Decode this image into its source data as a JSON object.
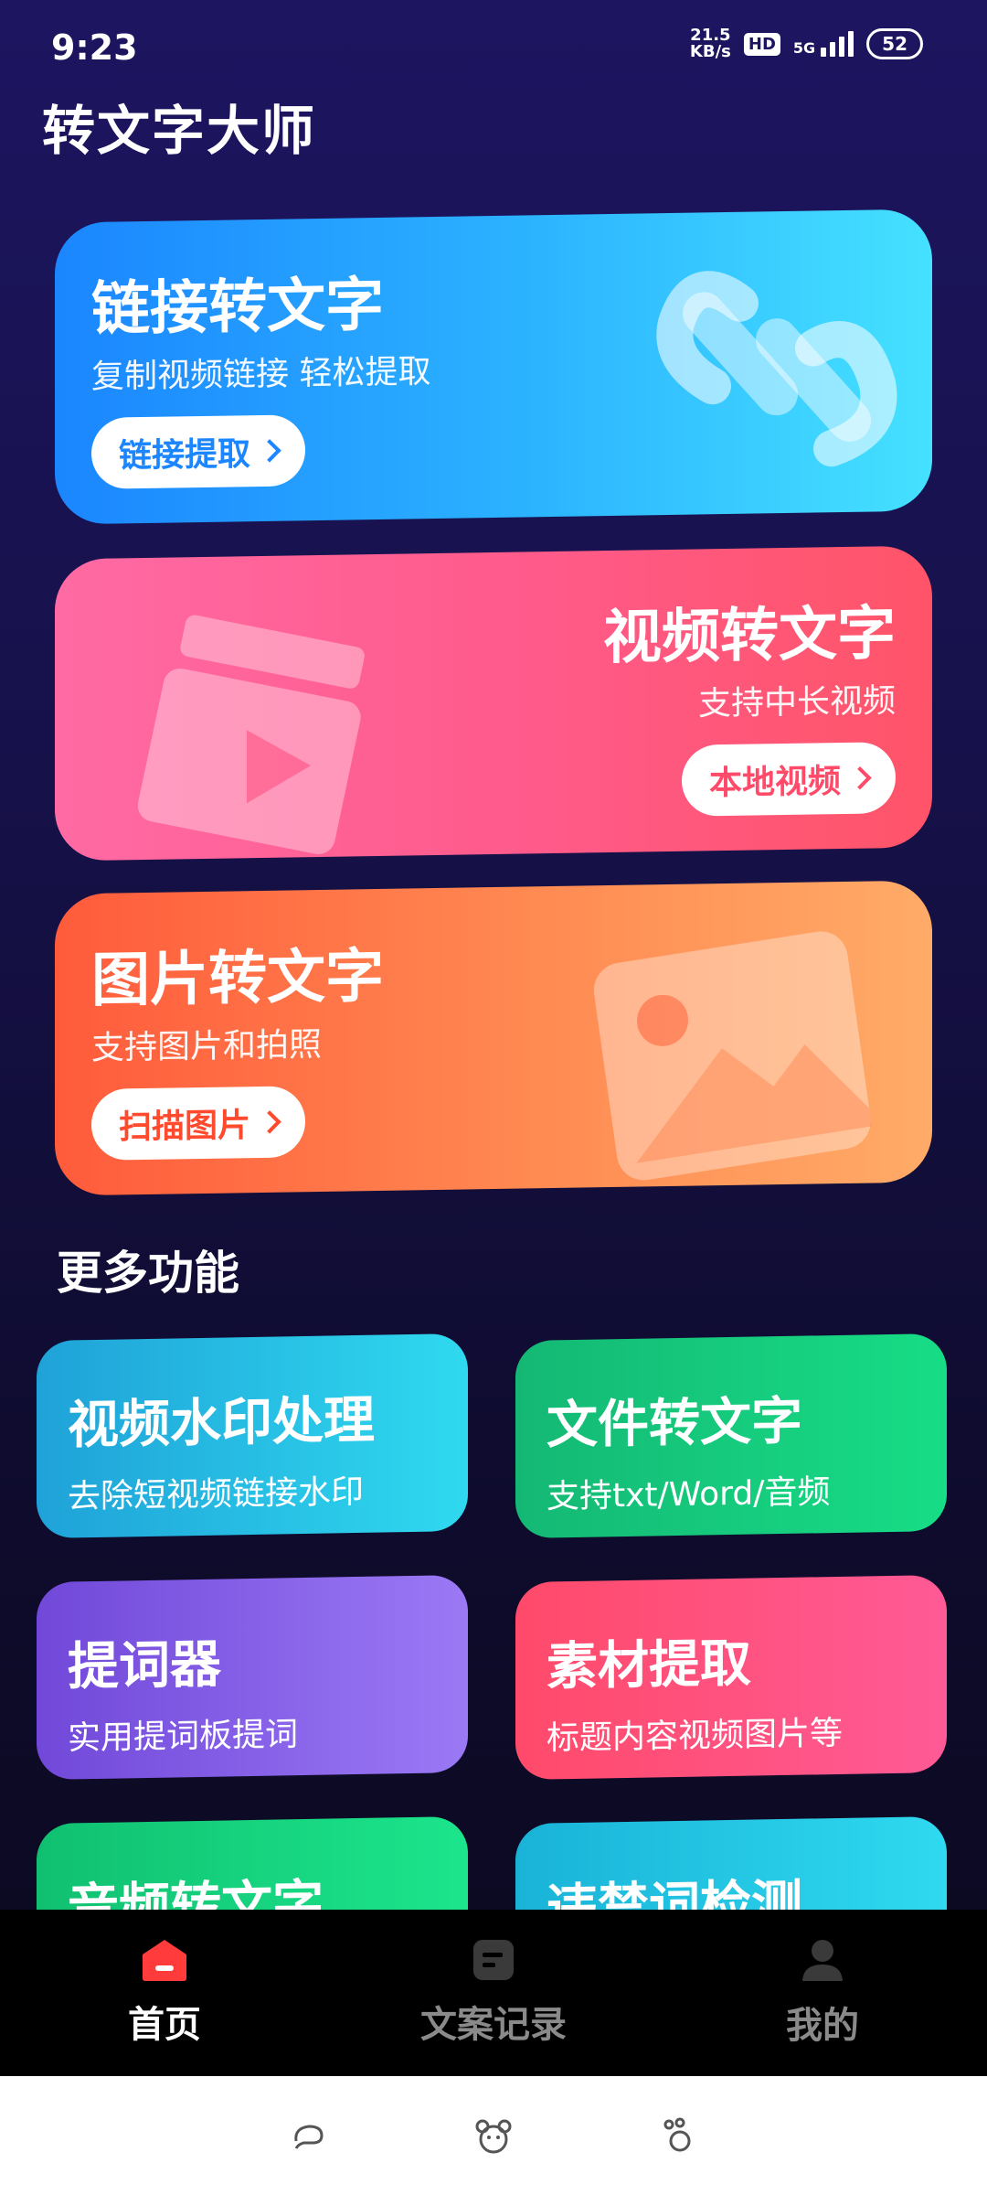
{
  "status_bar": {
    "time": "9:23",
    "net_speed_value": "21.5",
    "net_speed_unit": "KB/s",
    "hd": "HD",
    "network": "5G",
    "battery": "52"
  },
  "app": {
    "title": "转文字大师"
  },
  "cards": {
    "link": {
      "title": "链接转文字",
      "subtitle": "复制视频链接 轻松提取",
      "button": "链接提取",
      "icon": "link-icon"
    },
    "video": {
      "title": "视频转文字",
      "subtitle": "支持中长视频",
      "button": "本地视频",
      "icon": "clapperboard-icon"
    },
    "image": {
      "title": "图片转文字",
      "subtitle": "支持图片和拍照",
      "button": "扫描图片",
      "icon": "image-icon"
    }
  },
  "more": {
    "title": "更多功能",
    "items": [
      {
        "title": "视频水印处理",
        "subtitle": "去除短视频链接水印"
      },
      {
        "title": "文件转文字",
        "subtitle": "支持txt/Word/音频"
      },
      {
        "title": "提词器",
        "subtitle": "实用提词板提词"
      },
      {
        "title": "素材提取",
        "subtitle": "标题内容视频图片等"
      },
      {
        "title": "音频转文字",
        "subtitle": ""
      },
      {
        "title": "违禁词检测",
        "subtitle": ""
      }
    ]
  },
  "nav": [
    {
      "label": "首页",
      "icon": "home-icon",
      "active": true
    },
    {
      "label": "文案记录",
      "icon": "document-icon",
      "active": false
    },
    {
      "label": "我的",
      "icon": "user-icon",
      "active": false
    }
  ],
  "colors": {
    "link_accent": "#1b86ff",
    "video_accent": "#ff5a8a",
    "image_accent": "#ff5b3b",
    "nav_active": "#ff3b3b",
    "nav_inactive": "#8a8a8a"
  }
}
